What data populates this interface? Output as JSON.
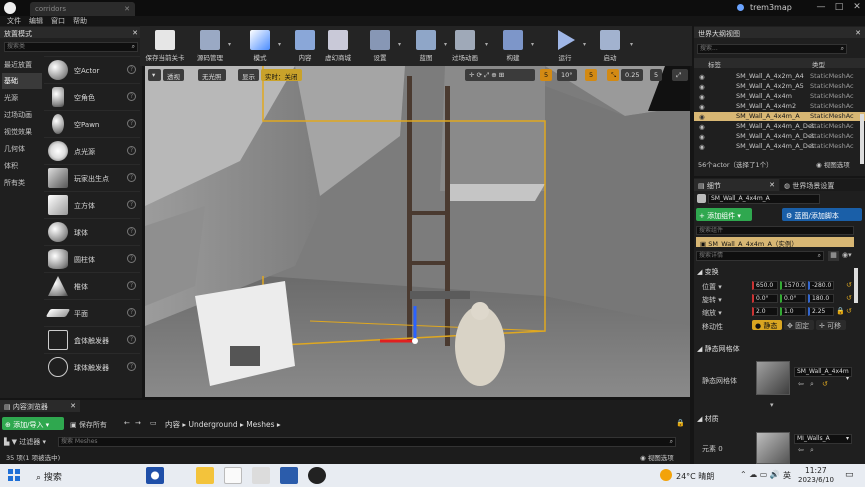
{
  "window": {
    "doc_tab": "corridors",
    "project": "trem3map",
    "min": "—",
    "max": "□",
    "close": "✕"
  },
  "menu": [
    "文件",
    "编辑",
    "窗口",
    "帮助"
  ],
  "modes": {
    "tab": "放置模式",
    "search_placeholder": "搜索类",
    "categories": [
      "最近放置",
      "基础",
      "光源",
      "过场动画",
      "视觉效果",
      "几何体",
      "体积",
      "所有类"
    ],
    "selected_category": 1,
    "items": [
      "空Actor",
      "空角色",
      "空Pawn",
      "点光源",
      "玩家出生点",
      "立方体",
      "球体",
      "圆柱体",
      "椎体",
      "平面",
      "盒体触发器",
      "球体触发器"
    ]
  },
  "toolbar": [
    "保存当前关卡",
    "源码管理",
    "模式",
    "内容",
    "虚幻商城",
    "设置",
    "蓝图",
    "过场动画",
    "构建",
    "运行",
    "启动"
  ],
  "viewport": {
    "perspective": "透视",
    "lit": "无光照",
    "show": "显示",
    "realtime": "实时：关闭",
    "grid": "10°",
    "snap1": "5",
    "snap2": "0.25",
    "camera": "5"
  },
  "outliner": {
    "title": "世界大纲视图",
    "search_placeholder": "搜索...",
    "col_label": "标签",
    "col_type": "类型",
    "rows": [
      {
        "n": "SM_Wall_A_4x2m_A4",
        "t": "StaticMeshAc"
      },
      {
        "n": "SM_Wall_A_4x2m_A5",
        "t": "StaticMeshAc"
      },
      {
        "n": "SM_Wall_A_4x4m",
        "t": "StaticMeshAc"
      },
      {
        "n": "SM_Wall_A_4x4m2",
        "t": "StaticMeshAc"
      },
      {
        "n": "SM_Wall_A_4x4m_A",
        "t": "StaticMeshAc"
      },
      {
        "n": "SM_Wall_A_4x4m_A_Det",
        "t": "StaticMeshAc"
      },
      {
        "n": "SM_Wall_A_4x4m_A_Det",
        "t": "StaticMeshAc"
      },
      {
        "n": "SM_Wall_A_4x4m_A_Det",
        "t": "StaticMeshAc"
      }
    ],
    "selected": 4,
    "status": "56个actor（选择了1个）",
    "view_options": "视图选项"
  },
  "details": {
    "tab1": "细节",
    "tab2": "世界场景设置",
    "name": "SM_Wall_A_4x4m_A",
    "add_component": "添加组件",
    "blueprint_btn": "蓝图/添加脚本",
    "search_comp": "搜索组件",
    "instance": "SM_Wall_A_4x4m_A（实例）",
    "search_details": "搜索详情",
    "transform": "变换",
    "loc_label": "位置",
    "rot_label": "旋转",
    "scale_label": "缩放",
    "mobility": "移动性",
    "loc": [
      "650.0",
      "1570.0",
      "-280.0"
    ],
    "rot": [
      "0.0°",
      "0.0°",
      "180.0"
    ],
    "scale": [
      "2.0",
      "1.0",
      "2.25"
    ],
    "mob": [
      "静态",
      "固定",
      "可移"
    ],
    "static_mesh_section": "静态网格体",
    "static_mesh_label": "静态网格体",
    "mesh_value": "SM_Wall_A_4x4m",
    "materials": "材质",
    "element0": "元素 0",
    "material_value": "MI_Walls_A"
  },
  "content": {
    "tab": "内容浏览器",
    "add_import": "添加/导入",
    "save_all": "保存所有",
    "path": [
      "内容",
      "Underground",
      "Meshes"
    ],
    "filter": "过滤器",
    "search_placeholder": "搜索 Meshes",
    "status": "35 项(1 项被选中)",
    "view_options": "视图选项"
  },
  "taskbar": {
    "search": "搜索",
    "weather": "24°C 晴朗",
    "ime": "英",
    "time": "11:27",
    "date": "2023/6/10"
  }
}
